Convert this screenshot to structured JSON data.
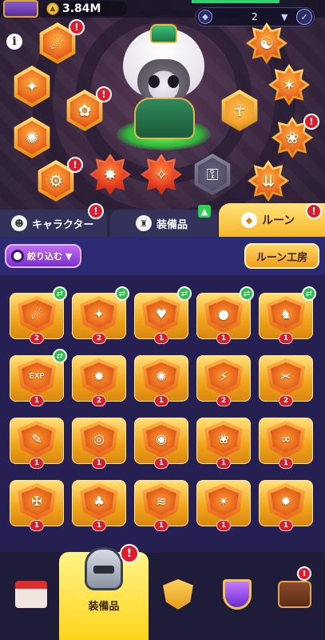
{
  "topbar": {
    "gold_amount": "3.84M",
    "selector_value": "2",
    "info_label": "i"
  },
  "badge_mark": "!",
  "tabs": {
    "character": "キャラクター",
    "equipment": "装備品",
    "rune": "ルーン"
  },
  "filter": {
    "label": "絞り込む"
  },
  "workshop": {
    "label": "ルーン工房"
  },
  "slots": [
    {
      "glyph": "☄",
      "alert": true
    },
    {
      "glyph": "✦",
      "alert": false
    },
    {
      "glyph": "✿",
      "alert": true
    },
    {
      "glyph": "✺",
      "alert": false
    },
    {
      "glyph": "⚙",
      "alert": true
    },
    {
      "glyph": "✸",
      "alert": false
    },
    {
      "glyph": "✧",
      "alert": false
    },
    {
      "glyph": "✵",
      "alert": false
    },
    {
      "glyph": "❀",
      "alert": true
    },
    {
      "glyph": "⇊",
      "alert": false
    },
    {
      "glyph": "☥",
      "alert": false
    },
    {
      "glyph": "✶",
      "alert": false
    },
    {
      "glyph": "☯",
      "alert": false
    }
  ],
  "runes": [
    {
      "glyph": "☄",
      "level": "2",
      "swap": true
    },
    {
      "glyph": "✦",
      "level": "2",
      "swap": true
    },
    {
      "glyph": "♥",
      "level": "1",
      "swap": true
    },
    {
      "glyph": "●",
      "level": "1",
      "swap": true
    },
    {
      "glyph": "♞",
      "level": "1",
      "swap": true
    },
    {
      "glyph": "EXP",
      "level": "1",
      "swap": true
    },
    {
      "glyph": "✹",
      "level": "2",
      "swap": false
    },
    {
      "glyph": "✺",
      "level": "1",
      "swap": false
    },
    {
      "glyph": "⚡",
      "level": "2",
      "swap": false
    },
    {
      "glyph": "✂",
      "level": "2",
      "swap": false
    },
    {
      "glyph": "✎",
      "level": "1",
      "swap": false
    },
    {
      "glyph": "◎",
      "level": "1",
      "swap": false
    },
    {
      "glyph": "◉",
      "level": "1",
      "swap": false
    },
    {
      "glyph": "❀",
      "level": "1",
      "swap": false
    },
    {
      "glyph": "∞",
      "level": "1",
      "swap": false
    },
    {
      "glyph": "✠",
      "level": "1",
      "swap": false
    },
    {
      "glyph": "♣",
      "level": "1",
      "swap": false
    },
    {
      "glyph": "≋",
      "level": "1",
      "swap": false
    },
    {
      "glyph": "✴",
      "level": "1",
      "swap": false
    },
    {
      "glyph": "✹",
      "level": "1",
      "swap": false
    }
  ],
  "nav": {
    "active_label": "装備品"
  },
  "colors": {
    "accent_gold": "#ffd51a",
    "alert_red": "#e11b2c",
    "swap_green": "#2fbd4a"
  }
}
